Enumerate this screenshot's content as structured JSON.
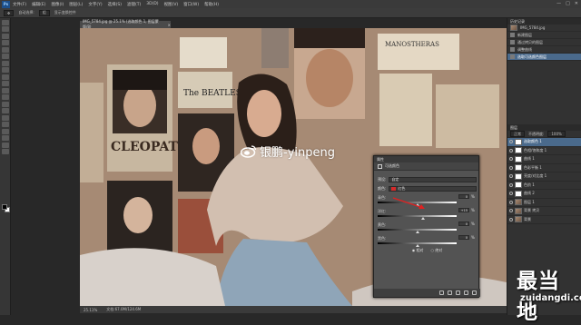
{
  "app": {
    "logo": "Ps",
    "menu": [
      "文件(F)",
      "编辑(E)",
      "图像(I)",
      "图层(L)",
      "文字(Y)",
      "选择(S)",
      "滤镜(T)",
      "3D(D)",
      "视图(V)",
      "窗口(W)",
      "帮助(H)"
    ],
    "window_controls": [
      "—",
      "□",
      "✕"
    ]
  },
  "options_bar": {
    "tool_option": "自动选择:",
    "target": "组",
    "show_transform": "显示变换控件"
  },
  "document": {
    "tab_title": "IMG_5784.jpg @ 25.1% (选取颜色 1, 图层蒙版/8)",
    "zoom": "25.11%",
    "doc_info": "文档:67.0M/124.6M"
  },
  "photo": {
    "poster_text_cleopatra": "CLEOPATRA",
    "poster_text_beatles": "The BEATLES",
    "poster_text_manhattan": "MANOSTHERAS"
  },
  "history": {
    "header": "历史记录",
    "snapshot": "IMG_5784.jpg",
    "items": [
      {
        "label": "新建图层",
        "selected": false
      },
      {
        "label": "通过拷贝的图层",
        "selected": false
      },
      {
        "label": "调整曲线",
        "selected": false
      },
      {
        "label": "选取可选颜色图层",
        "selected": true
      }
    ]
  },
  "layers": {
    "header": "图层",
    "blend_mode": "正常",
    "opacity_label": "不透明度:",
    "opacity": "100%",
    "rows": [
      {
        "name": "选取颜色 1",
        "selected": true,
        "thumb": "mask"
      },
      {
        "name": "色相/饱和度 1",
        "selected": false,
        "thumb": "mask"
      },
      {
        "name": "曲线 1",
        "selected": false,
        "thumb": "mask"
      },
      {
        "name": "色彩平衡 1",
        "selected": false,
        "thumb": "mask"
      },
      {
        "name": "亮度/对比度 1",
        "selected": false,
        "thumb": "mask"
      },
      {
        "name": "色阶 1",
        "selected": false,
        "thumb": "mask"
      },
      {
        "name": "曲线 2",
        "selected": false,
        "thumb": "mask"
      },
      {
        "name": "图层 1",
        "selected": false,
        "thumb": "photo"
      },
      {
        "name": "背景 拷贝",
        "selected": false,
        "thumb": "photo"
      },
      {
        "name": "背景",
        "selected": false,
        "thumb": "photo"
      }
    ]
  },
  "properties_dialog": {
    "title": "属性",
    "subtitle": "可选颜色",
    "preset_label": "预设:",
    "preset_value": "自定",
    "colors_label": "颜色:",
    "colors_value": "红色",
    "sliders": [
      {
        "label": "青色:",
        "value": "0"
      },
      {
        "label": "洋红:",
        "value": "+15"
      },
      {
        "label": "黄色:",
        "value": "0"
      },
      {
        "label": "黑色:",
        "value": "0"
      }
    ],
    "percent": "%",
    "mode_relative": "相对",
    "mode_absolute": "绝对"
  },
  "watermark": {
    "text": "银鹏-yinpeng"
  },
  "corner_logo": {
    "big": "最当地",
    "small": "zuidangdi.com"
  }
}
